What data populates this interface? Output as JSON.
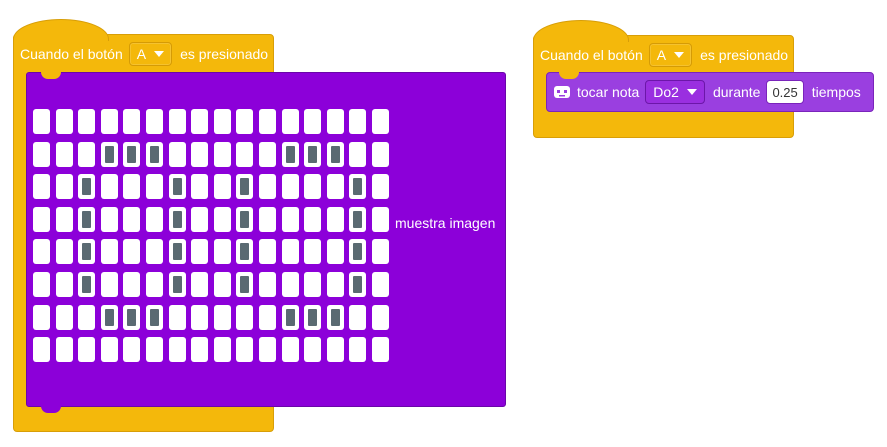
{
  "event_block_1": {
    "prefix": "Cuando el botón",
    "button_value": "A",
    "suffix": "es presionado"
  },
  "show_image_block": {
    "label": "muestra imagen",
    "rows": 8,
    "cols": 16,
    "leds": [
      "0000000000000000",
      "0001110000011100",
      "0010001001000010",
      "0010001001000010",
      "0010001001000010",
      "0010001001000010",
      "0001110000011100",
      "0000000000000000"
    ]
  },
  "event_block_2": {
    "prefix": "Cuando el botón",
    "button_value": "A",
    "suffix": "es presionado"
  },
  "play_note_block": {
    "icon": "robot-icon",
    "label": "tocar nota",
    "note_value": "Do2",
    "during_label": "durante",
    "beats_value": "0.25",
    "beats_label": "tiempos"
  },
  "colors": {
    "event_yellow": "#f4b80b",
    "display_purple": "#8c00d9",
    "music_purple": "#9a3fe0",
    "led_on": "#5a6a72",
    "led_off": "#ffffff"
  }
}
